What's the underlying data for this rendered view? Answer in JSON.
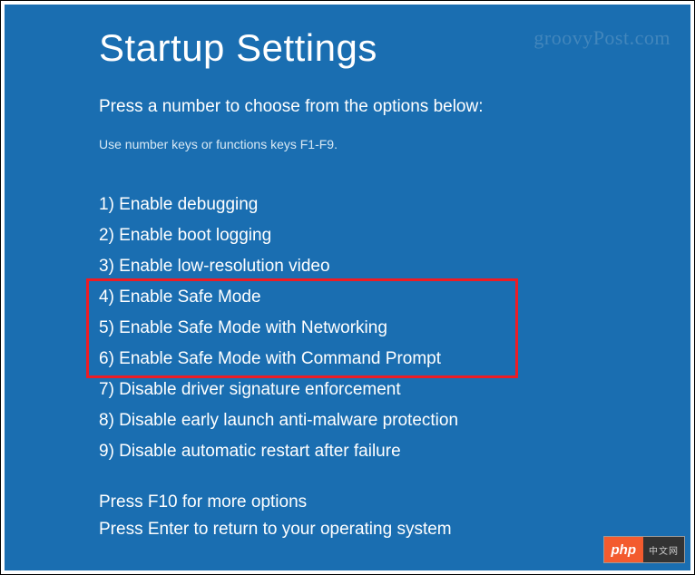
{
  "title": "Startup Settings",
  "subtitle": "Press a number to choose from the options below:",
  "hint": "Use number keys or functions keys F1-F9.",
  "options": [
    "1) Enable debugging",
    "2) Enable boot logging",
    "3) Enable low-resolution video",
    "4) Enable Safe Mode",
    "5) Enable Safe Mode with Networking",
    "6) Enable Safe Mode with Command Prompt",
    "7) Disable driver signature enforcement",
    "8) Disable early launch anti-malware protection",
    "9) Disable automatic restart after failure"
  ],
  "footer": {
    "line1": "Press F10 for more options",
    "line2": "Press Enter to return to your operating system"
  },
  "watermark_top": "groovyPost.com",
  "watermark_bottom": {
    "left": "php",
    "right": "中文网"
  }
}
